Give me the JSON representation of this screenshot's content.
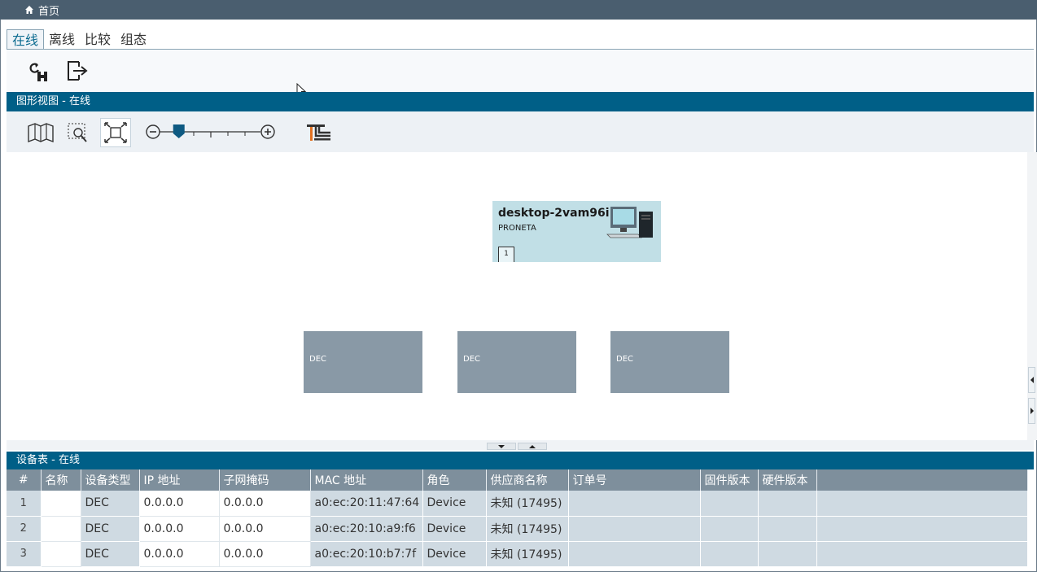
{
  "titlebar": {
    "home_label": "首页"
  },
  "tabs": [
    {
      "label": "在线",
      "active": true
    },
    {
      "label": "离线",
      "active": false
    },
    {
      "label": "比较",
      "active": false
    },
    {
      "label": "组态",
      "active": false
    }
  ],
  "toolbar": {
    "icons": [
      "refresh-network-icon",
      "export-icon"
    ]
  },
  "graphic_view": {
    "title": "图形视图 - 在线",
    "tools": [
      "map-icon",
      "zoom-region-icon",
      "fit-to-screen-icon",
      "zoom-out-icon",
      "zoom-in-icon",
      "topology-icon"
    ],
    "zoom_level": 0.12,
    "pc_node": {
      "name": "desktop-2vam96i",
      "subtitle": "PRONETA",
      "port": "1"
    },
    "devices": [
      {
        "label": "DEC"
      },
      {
        "label": "DEC"
      },
      {
        "label": "DEC"
      }
    ]
  },
  "device_table": {
    "title": "设备表 - 在线",
    "columns": [
      "#",
      "名称",
      "设备类型",
      "IP 地址",
      "子网掩码",
      "MAC 地址",
      "角色",
      "供应商名称",
      "订单号",
      "固件版本",
      "硬件版本"
    ],
    "rows": [
      [
        "1",
        "",
        "DEC",
        "0.0.0.0",
        "0.0.0.0",
        "a0:ec:20:11:47:64",
        "Device",
        "未知 (17495)",
        "",
        "",
        ""
      ],
      [
        "2",
        "",
        "DEC",
        "0.0.0.0",
        "0.0.0.0",
        "a0:ec:20:10:a9:f6",
        "Device",
        "未知 (17495)",
        "",
        "",
        ""
      ],
      [
        "3",
        "",
        "DEC",
        "0.0.0.0",
        "0.0.0.0",
        "a0:ec:20:10:b7:7f",
        "Device",
        "未知 (17495)",
        "",
        "",
        ""
      ]
    ]
  },
  "colors": {
    "header_blue": "#005f87",
    "titlebar": "#4a5e6f",
    "pc_node_bg": "#c1dfe6",
    "device_node_bg": "#8999a6"
  }
}
